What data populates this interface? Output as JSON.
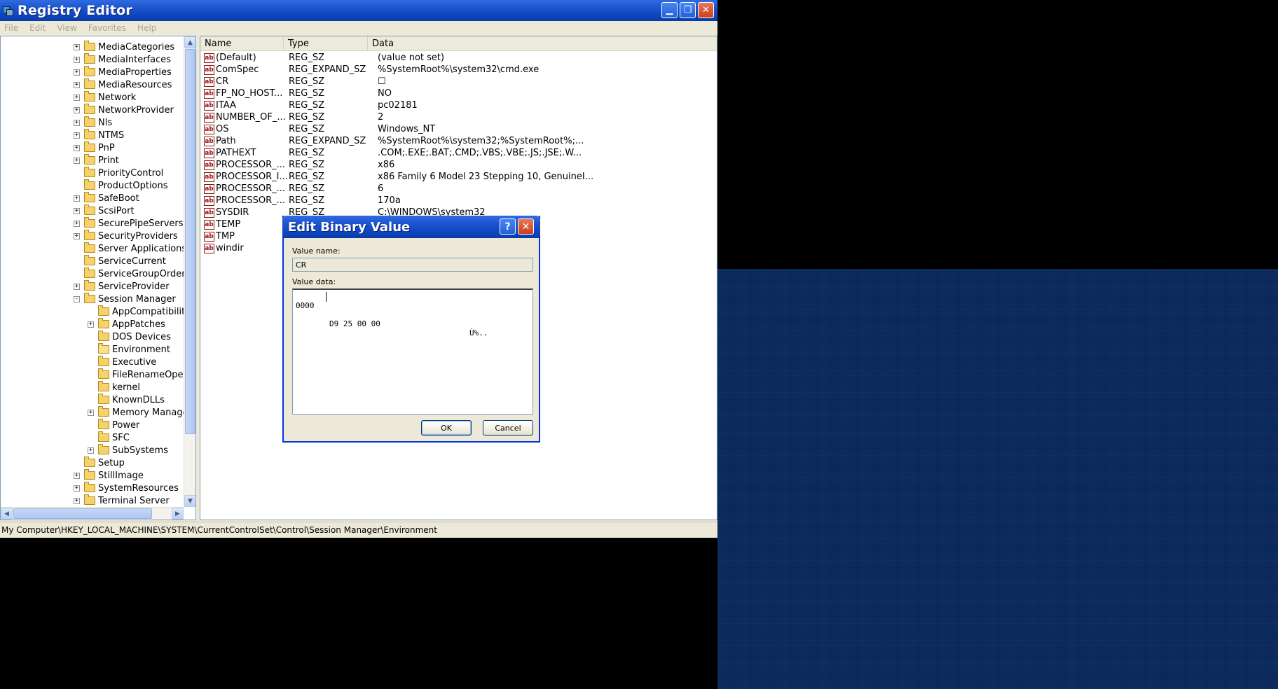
{
  "window": {
    "title": "Registry Editor"
  },
  "menu": [
    "File",
    "Edit",
    "View",
    "Favorites",
    "Help"
  ],
  "tree": [
    {
      "label": "MediaCategories",
      "level": 0,
      "expander": "+"
    },
    {
      "label": "MediaInterfaces",
      "level": 0,
      "expander": "+"
    },
    {
      "label": "MediaProperties",
      "level": 0,
      "expander": "+"
    },
    {
      "label": "MediaResources",
      "level": 0,
      "expander": "+"
    },
    {
      "label": "Network",
      "level": 0,
      "expander": "+"
    },
    {
      "label": "NetworkProvider",
      "level": 0,
      "expander": "+"
    },
    {
      "label": "Nls",
      "level": 0,
      "expander": "+"
    },
    {
      "label": "NTMS",
      "level": 0,
      "expander": "+"
    },
    {
      "label": "PnP",
      "level": 0,
      "expander": "+"
    },
    {
      "label": "Print",
      "level": 0,
      "expander": "+"
    },
    {
      "label": "PriorityControl",
      "level": 0,
      "expander": ""
    },
    {
      "label": "ProductOptions",
      "level": 0,
      "expander": ""
    },
    {
      "label": "SafeBoot",
      "level": 0,
      "expander": "+"
    },
    {
      "label": "ScsiPort",
      "level": 0,
      "expander": "+"
    },
    {
      "label": "SecurePipeServers",
      "level": 0,
      "expander": "+"
    },
    {
      "label": "SecurityProviders",
      "level": 0,
      "expander": "+"
    },
    {
      "label": "Server Applications",
      "level": 0,
      "expander": ""
    },
    {
      "label": "ServiceCurrent",
      "level": 0,
      "expander": ""
    },
    {
      "label": "ServiceGroupOrder",
      "level": 0,
      "expander": ""
    },
    {
      "label": "ServiceProvider",
      "level": 0,
      "expander": "+"
    },
    {
      "label": "Session Manager",
      "level": 0,
      "expander": "-"
    },
    {
      "label": "AppCompatibility",
      "level": 1,
      "expander": ""
    },
    {
      "label": "AppPatches",
      "level": 1,
      "expander": "+"
    },
    {
      "label": "DOS Devices",
      "level": 1,
      "expander": ""
    },
    {
      "label": "Environment",
      "level": 1,
      "expander": "",
      "open": true
    },
    {
      "label": "Executive",
      "level": 1,
      "expander": ""
    },
    {
      "label": "FileRenameOpera",
      "level": 1,
      "expander": ""
    },
    {
      "label": "kernel",
      "level": 1,
      "expander": ""
    },
    {
      "label": "KnownDLLs",
      "level": 1,
      "expander": ""
    },
    {
      "label": "Memory Managen",
      "level": 1,
      "expander": "+"
    },
    {
      "label": "Power",
      "level": 1,
      "expander": ""
    },
    {
      "label": "SFC",
      "level": 1,
      "expander": ""
    },
    {
      "label": "SubSystems",
      "level": 1,
      "expander": "+"
    },
    {
      "label": "Setup",
      "level": 0,
      "expander": ""
    },
    {
      "label": "StillImage",
      "level": 0,
      "expander": "+"
    },
    {
      "label": "SystemResources",
      "level": 0,
      "expander": "+"
    },
    {
      "label": "Terminal Server",
      "level": 0,
      "expander": "+"
    }
  ],
  "columns": {
    "name": "Name",
    "type": "Type",
    "data": "Data"
  },
  "rows": [
    {
      "name": "(Default)",
      "type": "REG_SZ",
      "data": "(value not set)"
    },
    {
      "name": "ComSpec",
      "type": "REG_EXPAND_SZ",
      "data": "%SystemRoot%\\system32\\cmd.exe"
    },
    {
      "name": "CR",
      "type": "REG_SZ",
      "data": "☐"
    },
    {
      "name": "FP_NO_HOST...",
      "type": "REG_SZ",
      "data": "NO"
    },
    {
      "name": "ITAA",
      "type": "REG_SZ",
      "data": "pc02181"
    },
    {
      "name": "NUMBER_OF_...",
      "type": "REG_SZ",
      "data": "2"
    },
    {
      "name": "OS",
      "type": "REG_SZ",
      "data": "Windows_NT"
    },
    {
      "name": "Path",
      "type": "REG_EXPAND_SZ",
      "data": "%SystemRoot%\\system32;%SystemRoot%;..."
    },
    {
      "name": "PATHEXT",
      "type": "REG_SZ",
      "data": ".COM;.EXE;.BAT;.CMD;.VBS;.VBE;.JS;.JSE;.W..."
    },
    {
      "name": "PROCESSOR_...",
      "type": "REG_SZ",
      "data": "x86"
    },
    {
      "name": "PROCESSOR_I...",
      "type": "REG_SZ",
      "data": "x86 Family 6 Model 23 Stepping 10, GenuineI..."
    },
    {
      "name": "PROCESSOR_...",
      "type": "REG_SZ",
      "data": "6"
    },
    {
      "name": "PROCESSOR_...",
      "type": "REG_SZ",
      "data": "170a"
    },
    {
      "name": "SYSDIR",
      "type": "REG_SZ",
      "data": "C:\\WINDOWS\\system32"
    },
    {
      "name": "TEMP",
      "type": "",
      "data": ""
    },
    {
      "name": "TMP",
      "type": "",
      "data": ""
    },
    {
      "name": "windir",
      "type": "",
      "data": ""
    }
  ],
  "status": "My Computer\\HKEY_LOCAL_MACHINE\\SYSTEM\\CurrentControlSet\\Control\\Session Manager\\Environment",
  "dialog": {
    "title": "Edit Binary Value",
    "help": "?",
    "close": "✕",
    "value_name_label": "Value name:",
    "value_name": "CR",
    "value_data_label": "Value data:",
    "addr": "0000",
    "hex": "D9 25 00 00",
    "ascii": "Ù%..",
    "ok": "OK",
    "cancel": "Cancel"
  },
  "icons": {
    "app": "registry-icon",
    "value": "string-value-icon",
    "folder": "folder-icon"
  },
  "colors": {
    "titlebar": "#0c43bb",
    "desktop": "#0a2a5e",
    "window_bg": "#ece9d8"
  }
}
